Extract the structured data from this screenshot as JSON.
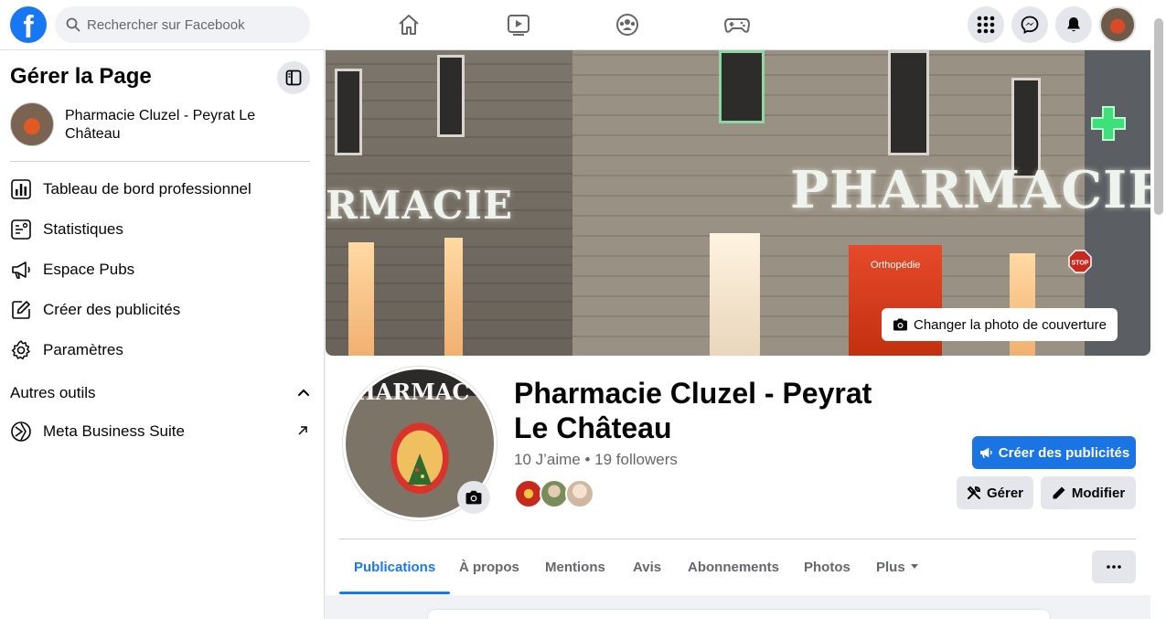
{
  "topbar": {
    "logo": "f",
    "search_placeholder": "Rechercher sur Facebook"
  },
  "sidebar": {
    "title": "Gérer la Page",
    "page_name": "Pharmacie Cluzel - Peyrat Le Château",
    "items": [
      {
        "label": "Tableau de bord professionnel",
        "icon": "dashboard-icon"
      },
      {
        "label": "Statistiques",
        "icon": "insights-icon"
      },
      {
        "label": "Espace Pubs",
        "icon": "megaphone-icon"
      },
      {
        "label": "Créer des publicités",
        "icon": "edit-icon"
      },
      {
        "label": "Paramètres",
        "icon": "gear-icon"
      }
    ],
    "section_title": "Autres outils",
    "tools": [
      {
        "label": "Meta Business Suite",
        "icon": "meta-business-icon"
      }
    ]
  },
  "cover": {
    "sign_left": "RMACIE",
    "sign_main": "PHARMACIE",
    "shop_sign": "Orthopédie",
    "stop_sign": "STOP",
    "change_cover_label": "Changer la photo de couverture"
  },
  "profile": {
    "avatar_sign": "HARMAC",
    "name": "Pharmacie Cluzel - Peyrat Le Château",
    "likes": "10 J’aime",
    "separator": " • ",
    "followers": "19 followers",
    "create_ads_label": "Créer des publicités",
    "manage_label": "Gérer",
    "edit_label": "Modifier"
  },
  "tabs": [
    {
      "label": "Publications",
      "active": true
    },
    {
      "label": "À propos"
    },
    {
      "label": "Mentions"
    },
    {
      "label": "Avis"
    },
    {
      "label": "Abonnements"
    },
    {
      "label": "Photos"
    },
    {
      "label": "Plus"
    }
  ],
  "colors": {
    "brand": "#1877f2",
    "button_primary": "#1b74e4",
    "secondary_bg": "#e4e6eb",
    "text_muted": "#65676b"
  }
}
